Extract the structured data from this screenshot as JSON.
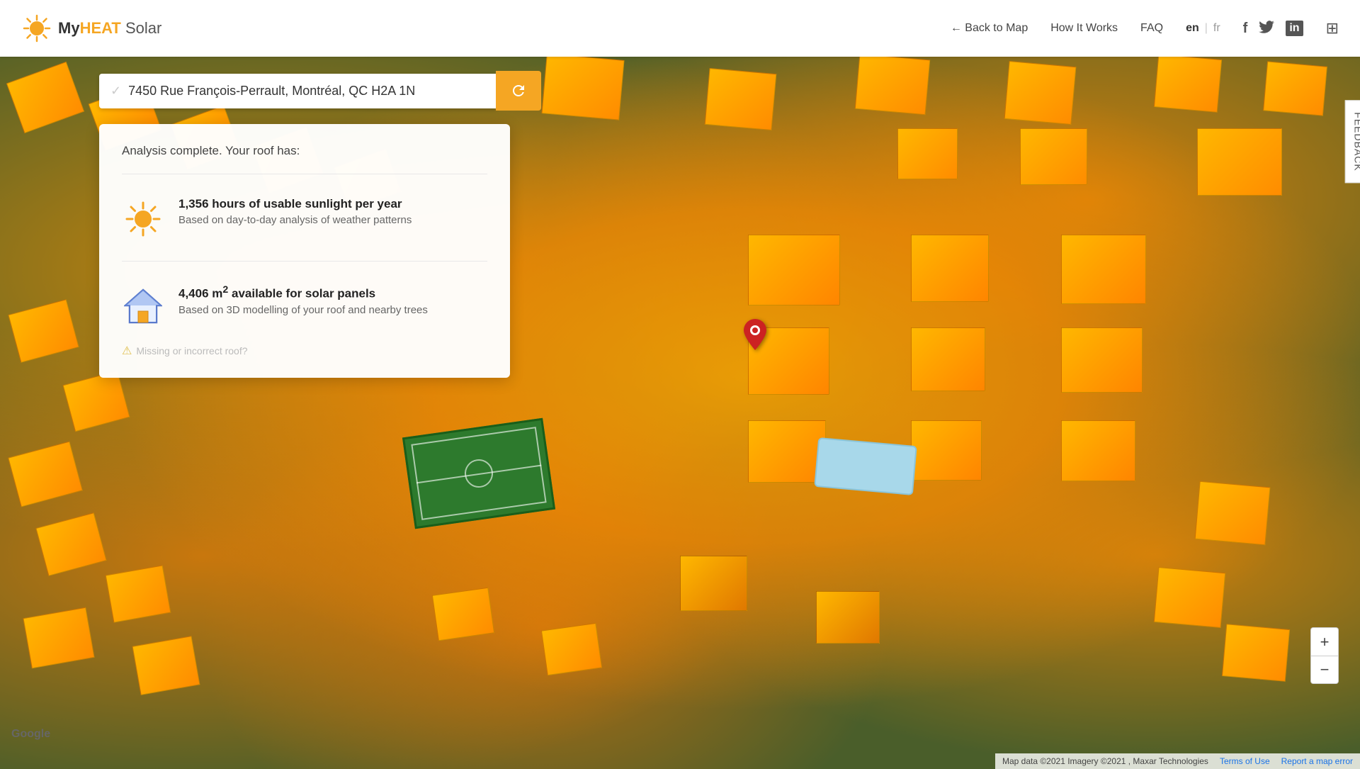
{
  "header": {
    "logo_text_my": "My",
    "logo_text_heat": "HEAT",
    "logo_text_solar": "Solar",
    "nav": {
      "back_to_map": "← Back to Map",
      "how_it_works": "How It Works",
      "faq": "FAQ",
      "lang_en": "en",
      "lang_fr": "fr"
    },
    "social": {
      "facebook": "f",
      "twitter": "𝕏",
      "linkedin": "in"
    }
  },
  "address_bar": {
    "address": "7450 Rue François-Perrault, Montréal, QC H2A 1N",
    "refresh_icon": "↺"
  },
  "analysis": {
    "title": "Analysis complete. Your roof has:",
    "stat1": {
      "value": "1,356 hours of usable sunlight per year",
      "detail": "Based on day-to-day analysis of weather patterns"
    },
    "stat2": {
      "value_pre": "4,406 m",
      "value_sup": "2",
      "value_post": " available for solar panels",
      "detail": "Based on 3D modelling of your roof and nearby trees"
    },
    "missing_link": "Missing or incorrect roof?"
  },
  "map": {
    "google_label": "Google",
    "attribution": "Map data ©2021 Imagery ©2021 , Maxar Technologies",
    "terms": "Terms of Use",
    "report": "Report a map error"
  },
  "zoom": {
    "in": "+",
    "out": "−"
  },
  "feedback": {
    "label": "FEEDBACK"
  }
}
